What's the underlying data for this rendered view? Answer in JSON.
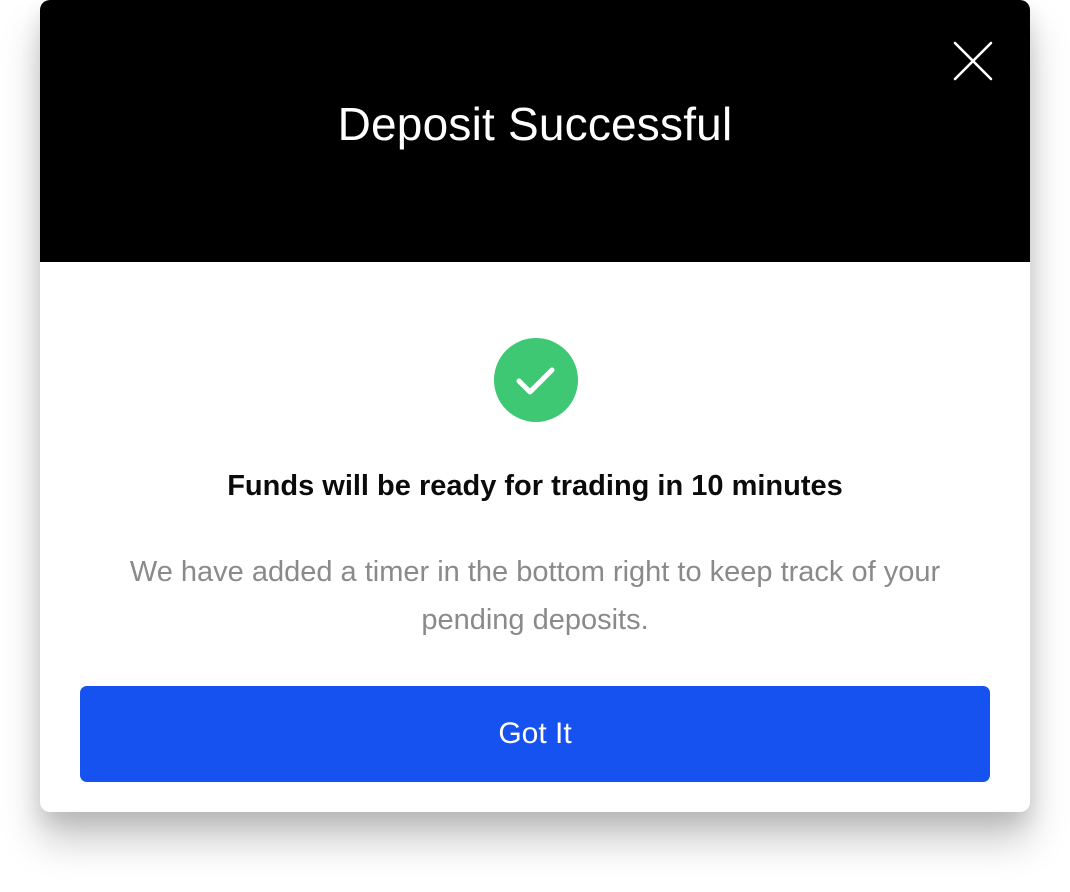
{
  "modal": {
    "title": "Deposit Successful",
    "close_icon": "close-icon",
    "status_icon": "check-circle-icon",
    "status_color": "#3ec874",
    "headline": "Funds will be ready for trading in 10 minutes",
    "description": "We have added a timer in the bottom right to keep track of your pending deposits.",
    "primary_button_label": "Got It",
    "primary_button_color": "#1652f0",
    "header_color": "#000000"
  }
}
